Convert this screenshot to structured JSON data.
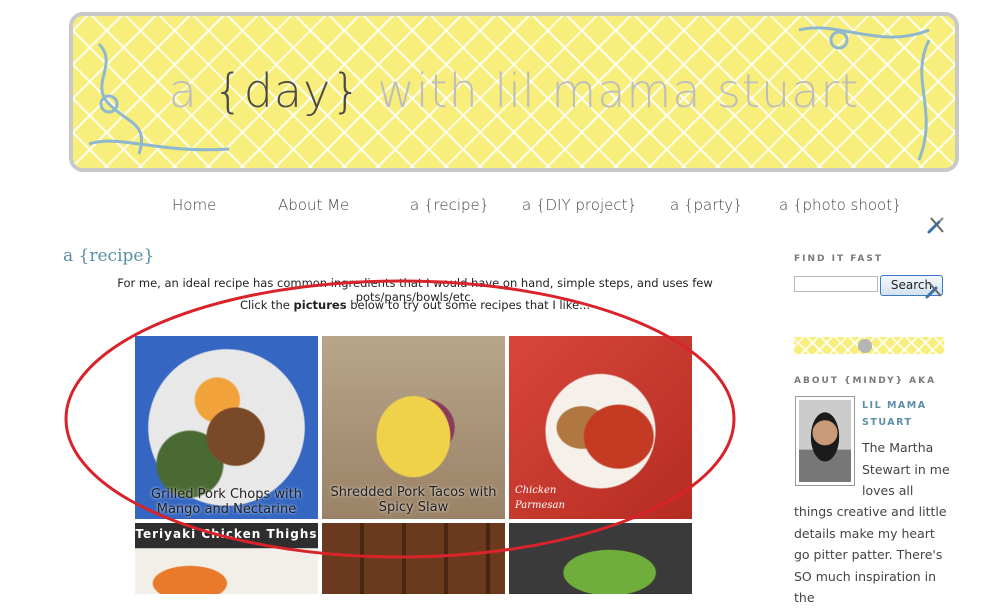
{
  "header": {
    "title_a": "a ",
    "title_day": "{day}",
    "title_rest": " with lil mama stuart"
  },
  "nav": {
    "items": [
      {
        "label": "Home"
      },
      {
        "label": "About Me"
      },
      {
        "label": "a {recipe}"
      },
      {
        "label": "a {DIY project}"
      },
      {
        "label": "a {party}"
      },
      {
        "label": "a {photo shoot}"
      }
    ]
  },
  "main": {
    "title": "a {recipe}",
    "intro_line1": "For me, an ideal recipe has common ingredients that I would have on hand, simple steps, and uses few pots/pans/bowls/etc.",
    "intro_line2_pre": "Click the ",
    "intro_line2_bold": "pictures",
    "intro_line2_post": " below to try out some recipes that I like...",
    "recipes": [
      {
        "caption": "Grilled Pork Chops with Mango and Nectarine"
      },
      {
        "caption": "Shredded Pork Tacos with Spicy Slaw"
      },
      {
        "caption": "Chicken Parmesan"
      },
      {
        "caption": "Teriyaki Chicken Thighs"
      },
      {
        "caption": ""
      },
      {
        "caption": ""
      }
    ]
  },
  "sidebar": {
    "find_heading": "FIND IT FAST",
    "search_placeholder": "",
    "search_button": "Search",
    "about_heading": "ABOUT {MINDY} AKA",
    "about_name": "LIL MAMA STUART",
    "about_text1": "The Martha Stewart in me loves all",
    "about_text2": "things creative and little details make my heart go pitter patter. There's SO much inspiration in the"
  },
  "colors": {
    "banner_yellow": "#f7ee7c",
    "accent_teal": "#5a8fa6",
    "annotation_red": "#d9232a"
  }
}
